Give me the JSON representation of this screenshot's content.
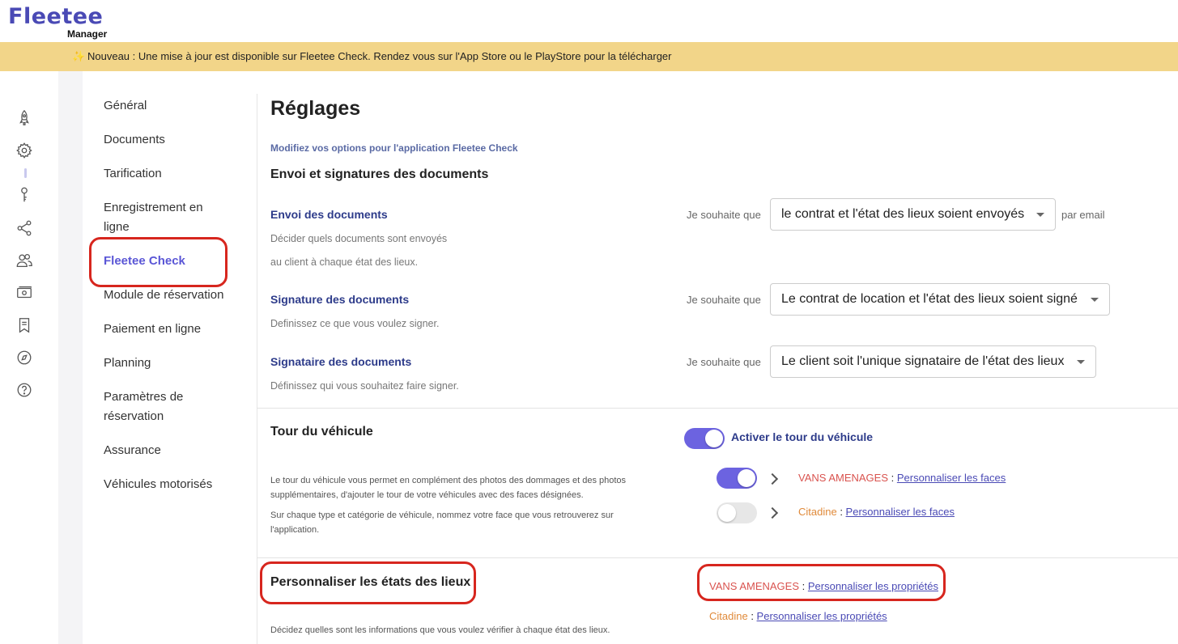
{
  "header": {
    "logo_text": "Fleetee",
    "logo_subtext": "Manager"
  },
  "banner": {
    "icon": "sparkle-icon",
    "text": "Nouveau : Une mise à jour est disponible sur Fleetee Check. Rendez vous sur l'App Store ou le PlayStore pour la télécharger",
    "background": "#f2d589"
  },
  "rail": {
    "icons": [
      "rocket-icon",
      "gear-icon",
      "key-icon",
      "share-icon",
      "users-icon",
      "money-icon",
      "bookmark-icon",
      "compass-icon",
      "help-icon"
    ]
  },
  "subnav": {
    "items": [
      {
        "label": "Général"
      },
      {
        "label": "Documents"
      },
      {
        "label": "Tarification"
      },
      {
        "label": "Enregistrement en ligne"
      },
      {
        "label": "Fleetee Check",
        "active": true
      },
      {
        "label": "Module de réservation"
      },
      {
        "label": "Paiement en ligne"
      },
      {
        "label": "Planning"
      },
      {
        "label": "Paramètres de réservation"
      },
      {
        "label": "Assurance"
      },
      {
        "label": "Véhicules motorisés"
      }
    ]
  },
  "main": {
    "title": "Réglages",
    "subtitle": "Modifiez vos options pour l'application Fleetee Check",
    "documents_section": {
      "title": "Envoi et signatures des documents",
      "rows": [
        {
          "title": "Envoi des documents",
          "desc1": "Décider quels documents sont envoyés",
          "desc2": "au client à chaque état des lieux.",
          "prefix": "Je souhaite que",
          "select_value": "le contrat et l'état des lieux soient envoyés",
          "suffix": "par email"
        },
        {
          "title": "Signature des documents",
          "desc1": "Definissez ce que vous voulez signer.",
          "prefix": "Je souhaite que",
          "select_value": "Le contrat de location et l'état des lieux soient signé"
        },
        {
          "title": "Signataire des documents",
          "desc1": "Définissez qui vous souhaitez faire signer.",
          "prefix": "Je souhaite que",
          "select_value": "Le client soit l'unique signataire de l'état des lieux"
        }
      ]
    },
    "tour_section": {
      "title": "Tour du véhicule",
      "desc1": "Le tour du véhicule vous permet en complément des photos des dommages et des photos supplémentaires, d'ajouter le tour de votre véhicules avec des faces désignées.",
      "desc2": "Sur chaque type et catégorie de véhicule, nommez votre face que vous retrouverez sur l'application.",
      "main_toggle_label": "Activer le tour du véhicule",
      "main_toggle_on": true,
      "vehicles": [
        {
          "name": "VANS AMENAGES",
          "sep": " : ",
          "link": "Personnaliser les faces",
          "enabled": true
        },
        {
          "name": "Citadine",
          "sep": " : ",
          "link": "Personnaliser les faces",
          "enabled": false
        }
      ]
    },
    "etats_section": {
      "title": "Personnaliser les états des lieux",
      "desc": "Décidez quelles sont les informations que vous voulez vérifier à chaque état des lieux.",
      "vehicles": [
        {
          "name": "VANS AMENAGES",
          "sep": " : ",
          "link": "Personnaliser les propriétés"
        },
        {
          "name": "Citadine",
          "sep": " : ",
          "link": "Personnaliser les propriétés"
        }
      ]
    }
  },
  "colors": {
    "accent": "#6c63e0",
    "nav_active": "#5a56d6",
    "highlight_ring": "#d7261e",
    "link": "#4a4ab5"
  }
}
